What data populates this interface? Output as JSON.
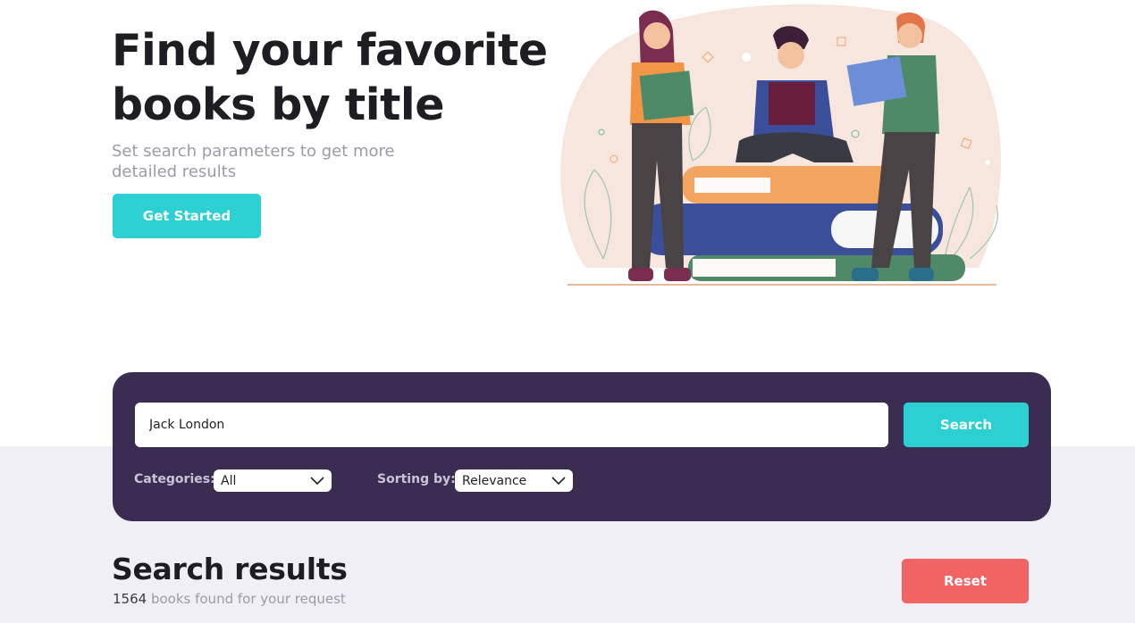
{
  "hero": {
    "title_line1": "Find your favorite",
    "title_line2": "books by title",
    "subtitle": "Set search parameters to get more detailed results",
    "cta_label": "Get Started",
    "illustration_icon": "people-reading-books-illustration"
  },
  "search": {
    "query_value": "Jack London",
    "button_label": "Search",
    "categories_label": "Categories:",
    "categories_selected": "All",
    "sorting_label": "Sorting by:",
    "sorting_selected": "Relevance",
    "chevron_icon": "chevron-down-icon"
  },
  "results": {
    "title": "Search results",
    "count": "1564",
    "count_suffix": " books found for your request",
    "reset_label": "Reset"
  },
  "colors": {
    "accent": "#2cd0d2",
    "panel": "#3b2d52",
    "reset": "#f16464",
    "band": "#efeff5"
  }
}
